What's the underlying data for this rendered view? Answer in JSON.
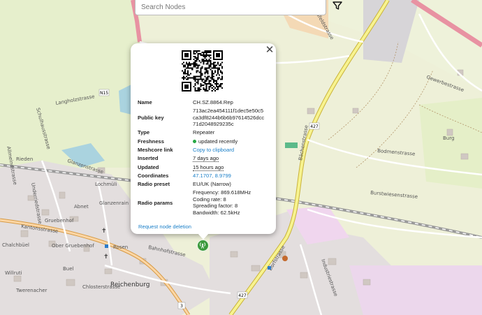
{
  "search": {
    "placeholder": "Search Nodes"
  },
  "icons": {
    "filter": "filter-icon",
    "close": "close-icon",
    "marker": "antenna-tower-icon",
    "qr": "qr-code-icon"
  },
  "colors": {
    "link": "#1a7fc8",
    "freshness_dot": "#27a844",
    "marker": "#3c9a3c"
  },
  "node": {
    "labels": {
      "name": "Name",
      "public_key": "Public key",
      "type": "Type",
      "freshness": "Freshness",
      "meshcore_link": "Meshcore link",
      "inserted": "Inserted",
      "updated": "Updated",
      "coordinates": "Coordinates",
      "radio_preset": "Radio preset",
      "radio_params": "Radio params"
    },
    "name": "CH.SZ.8864.Rep",
    "public_key_lines": [
      "713ac2ea454111f1dec5e50c5",
      "ca3df8244b6b6b97614526dcc",
      "71d2048929235c"
    ],
    "type": "Repeater",
    "freshness": "updated recently",
    "meshcore_link": "Copy to clipboard",
    "inserted": "7 days ago",
    "updated": "15 hours ago",
    "coordinates": "47.1707, 8.9799",
    "radio_preset": "EU/UK (Narrow)",
    "radio_params": [
      "Frequency: 869.618MHz",
      "Coding rate: 8",
      "Spreading factor: 8",
      "Bandwidth: 62.5kHz"
    ],
    "delete_link": "Request node deletion"
  },
  "map": {
    "place_labels": [
      "Reichenburg",
      "Glanzenrain",
      "Gruebenhof",
      "Ober Gruebenhof",
      "Chalchbüel",
      "Willruti",
      "Twerenacher",
      "Buel",
      "Rosen",
      "Lochmüli",
      "Abnet",
      "Burg"
    ],
    "street_labels": [
      "Kantonsstrasse",
      "Bahnhofstrasse",
      "Burstwiesenstrasse",
      "Bodmenstrasse",
      "Gewerbestrasse",
      "Langholzstrasse",
      "Schulhausstrasse",
      "Neufeldstrasse",
      "Bächenstrasse",
      "Allmeindstrasse",
      "Industriestrasse",
      "Chlosterstrasse",
      "Dorfstrasse",
      "Glanzenstrasse",
      "Rieden",
      "Underriedstrasse"
    ],
    "road_numbers": [
      "427",
      "427",
      "N15",
      "3"
    ]
  }
}
